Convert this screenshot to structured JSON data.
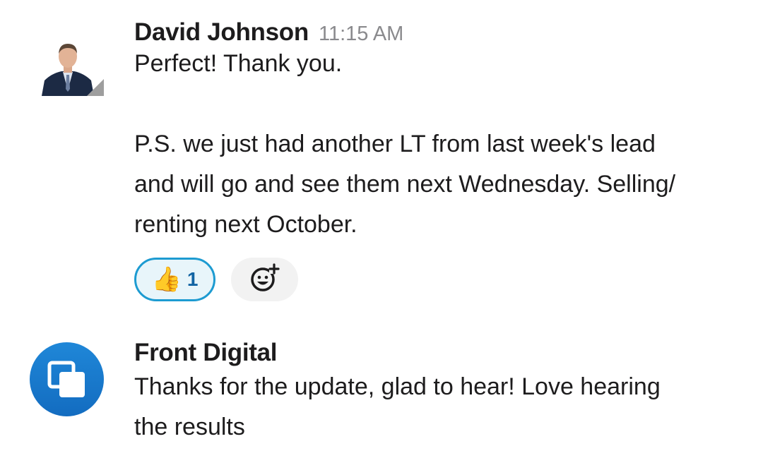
{
  "messages": [
    {
      "author": "David Johnson",
      "time": "11:15 AM",
      "lines": [
        "Perfect! Thank you.",
        "",
        "P.S. we just had another LT from last week's lead",
        "and will go and see them next Wednesday. Selling/",
        "renting next October."
      ],
      "reactions": [
        {
          "emoji": "👍",
          "count": "1"
        }
      ]
    },
    {
      "author": "Front Digital",
      "lines": [
        "Thanks for the update, glad to hear! Love hearing",
        "the results"
      ]
    }
  ],
  "colors": {
    "reaction_border": "#1d9bd1",
    "reaction_bg": "#e8f5fa",
    "front_avatar": "#1a7fd4"
  },
  "icons": {
    "add_reaction": "add-reaction-icon",
    "front_digital_logo": "overlapping-squares-icon"
  }
}
